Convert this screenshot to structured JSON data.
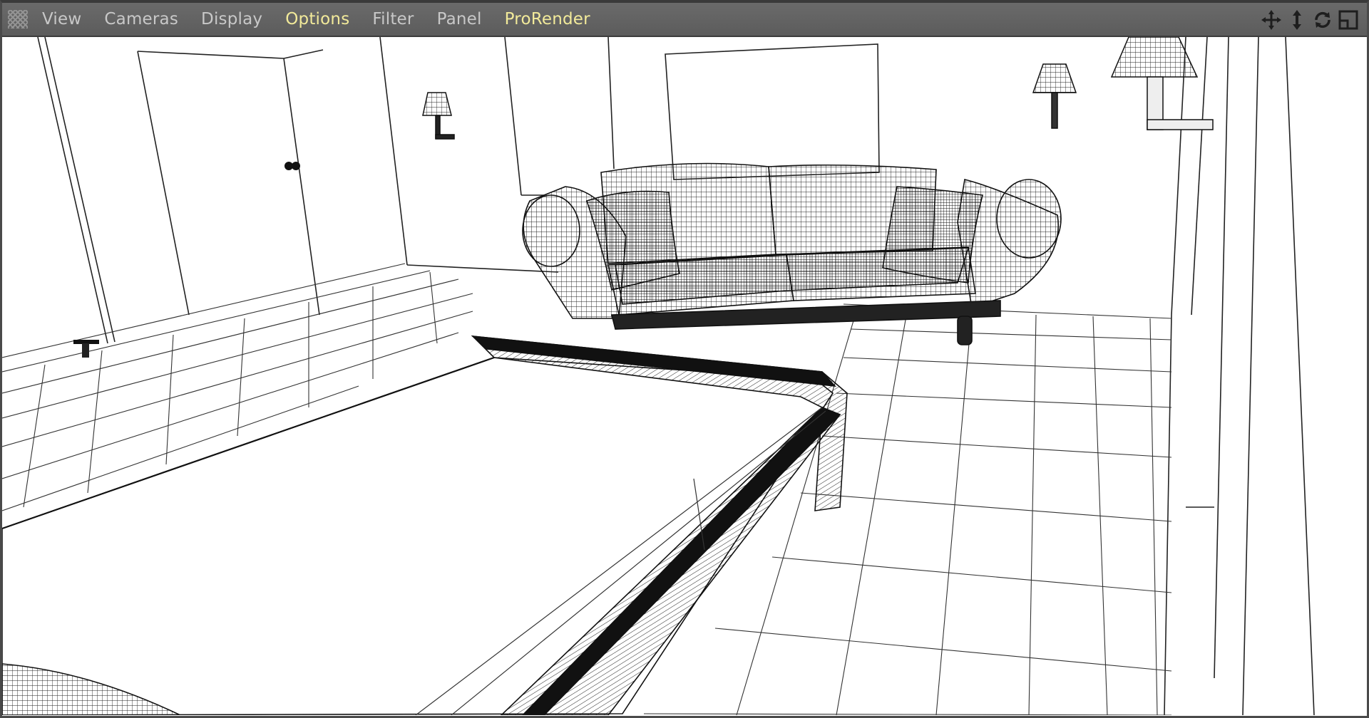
{
  "menubar": {
    "grip_icon": "grip-icon",
    "items": [
      {
        "label": "View",
        "highlight": false
      },
      {
        "label": "Cameras",
        "highlight": false
      },
      {
        "label": "Display",
        "highlight": false
      },
      {
        "label": "Options",
        "highlight": true
      },
      {
        "label": "Filter",
        "highlight": false
      },
      {
        "label": "Panel",
        "highlight": false
      },
      {
        "label": "ProRender",
        "highlight": true
      }
    ],
    "nav_icons": [
      "move-icon",
      "zoom-icon",
      "rotate-icon",
      "maximize-icon"
    ]
  },
  "colors": {
    "menubar_bg": "#5f5f5f",
    "menu_text": "#c8c8c8",
    "menu_highlight": "#f2ea9a",
    "viewport_bg": "#ffffff",
    "wire": "#1a1a1a"
  },
  "viewport": {
    "display_mode": "wireframe",
    "objects": [
      "bed",
      "sofa",
      "pillow-left",
      "pillow-right",
      "wall-lamp-left",
      "wall-lamp-right-small",
      "wall-lamp-right-large",
      "door",
      "picture-frame",
      "floor-tiles"
    ]
  }
}
